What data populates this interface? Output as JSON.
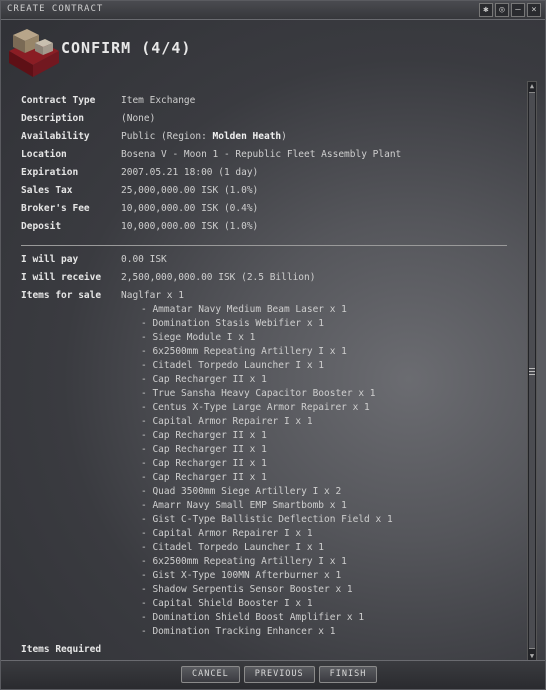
{
  "window": {
    "title": "CREATE CONTRACT",
    "heading": "CONFIRM (4/4)"
  },
  "fields": [
    {
      "label": "Contract Type",
      "value": "Item Exchange"
    },
    {
      "label": "Description",
      "value": "(None)"
    },
    {
      "label": "Availability",
      "value": "Public (Region: ",
      "bold": "Molden Heath",
      "tail": ")"
    },
    {
      "label": "Location",
      "value": "Bosena V - Moon 1 - Republic Fleet Assembly Plant"
    },
    {
      "label": "Expiration",
      "value": "2007.05.21 18:00 (1 day)"
    },
    {
      "label": "Sales Tax",
      "value": "25,000,000.00 ISK (1.0%)"
    },
    {
      "label": "Broker's Fee",
      "value": "10,000,000.00 ISK (0.4%)"
    },
    {
      "label": "Deposit",
      "value": "10,000,000.00 ISK (1.0%)"
    }
  ],
  "payment": [
    {
      "label": "I will pay",
      "value": "0.00 ISK"
    },
    {
      "label": "I will receive",
      "value": "2,500,000,000.00 ISK (2.5 Billion)"
    }
  ],
  "items_for_sale": {
    "label": "Items for sale",
    "main": "Naglfar x 1",
    "list": [
      "- Ammatar Navy Medium Beam Laser x 1",
      "- Domination Stasis Webifier x 1",
      "- Siege Module I x 1",
      "- 6x2500mm Repeating Artillery I x 1",
      "- Citadel Torpedo Launcher I x 1",
      "- Cap Recharger II x 1",
      "- True Sansha Heavy Capacitor Booster x 1",
      "- Centus X-Type Large Armor Repairer x 1",
      "- Capital Armor Repairer I x 1",
      "- Cap Recharger II x 1",
      "- Cap Recharger II x 1",
      "- Cap Recharger II x 1",
      "- Cap Recharger II x 1",
      "- Quad 3500mm Siege Artillery I x 2",
      "- Amarr Navy Small EMP Smartbomb x 1",
      "- Gist C-Type Ballistic Deflection Field x 1",
      "- Capital Armor Repairer I x 1",
      "- Citadel Torpedo Launcher I x 1",
      "- 6x2500mm Repeating Artillery I x 1",
      "- Gist X-Type 100MN Afterburner x 1",
      "- Shadow Serpentis Sensor Booster x 1",
      "- Capital Shield Booster I x 1",
      "- Domination Shield Boost Amplifier x 1",
      "- Domination Tracking Enhancer x 1"
    ]
  },
  "items_required": {
    "label": "Items Required"
  },
  "buttons": {
    "cancel": "CANCEL",
    "previous": "PREVIOUS",
    "finish": "FINISH"
  },
  "icons": {
    "header": "contract-crate-icon",
    "pin": "pin-icon",
    "options": "options-icon",
    "minimize": "minimize-icon",
    "close": "close-icon"
  },
  "colors": {
    "accent": "#b8202a",
    "text": "#d4d4d4"
  }
}
